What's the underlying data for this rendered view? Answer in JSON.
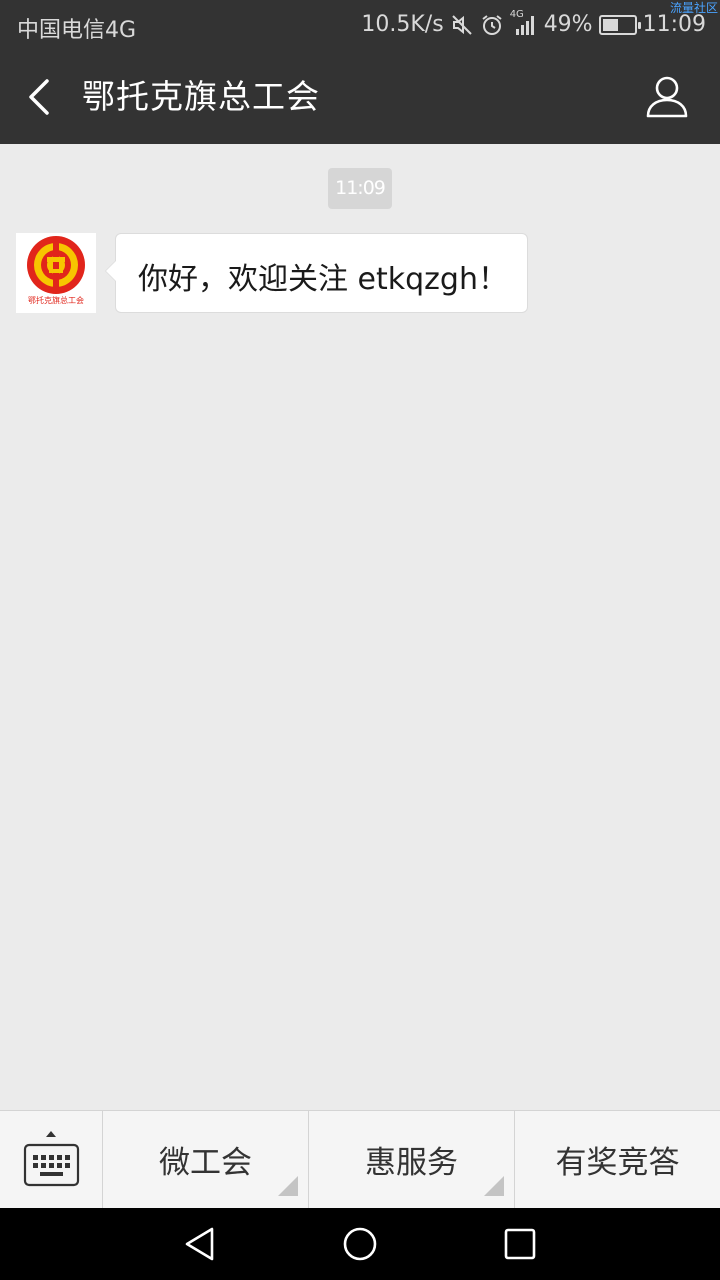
{
  "status_bar": {
    "carrier": "中国电信4G",
    "network_speed": "10.5K/s",
    "network_type": "4G",
    "battery_percent_text": "49%",
    "battery_level": 0.49,
    "time": "11:09",
    "watermark": "流量社区"
  },
  "header": {
    "title": "鄂托克旗总工会",
    "back_icon": "chevron-left-icon",
    "profile_icon": "person-icon"
  },
  "chat": {
    "timestamp": "11:09",
    "messages": [
      {
        "sender": "official-account",
        "avatar_caption": "鄂托克旗总工会",
        "text": "你好，欢迎关注 etkqzgh！"
      }
    ]
  },
  "menu_bar": {
    "keyboard_icon": "keyboard-icon",
    "items": [
      {
        "label": "微工会",
        "has_submenu": true
      },
      {
        "label": "惠服务",
        "has_submenu": true
      },
      {
        "label": "有奖竞答",
        "has_submenu": false
      }
    ]
  },
  "nav_bar": {
    "icons": [
      "back-triangle-icon",
      "home-circle-icon",
      "recents-square-icon"
    ]
  },
  "colors": {
    "header_bg": "#333333",
    "chat_bg": "#ebebeb",
    "logo_red": "#e1251b",
    "logo_yellow": "#f7c600"
  }
}
